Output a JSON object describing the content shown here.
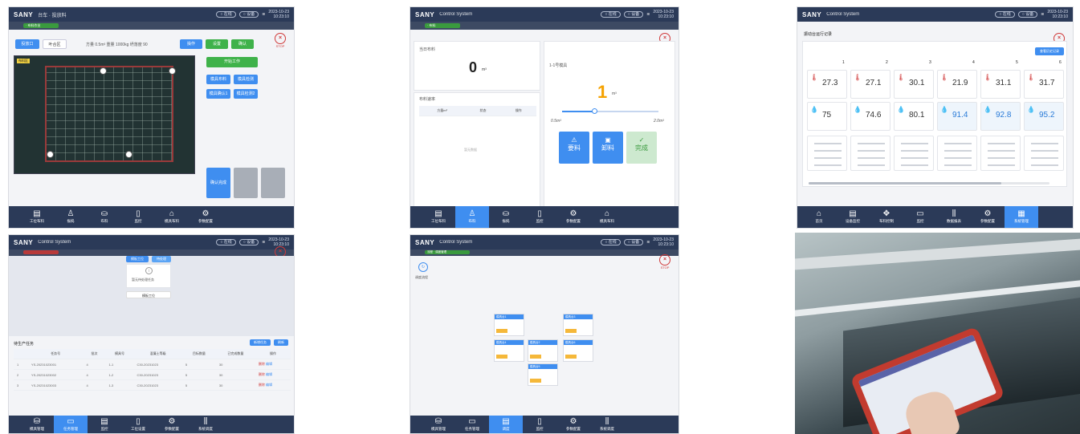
{
  "brand": "SANY",
  "panels": {
    "p1": {
      "title": "台车 · 投放料",
      "tabs": [
        "投放口",
        "叶合区"
      ],
      "meta": "方量 0.5m³  重量 1000kg  坍落度 90",
      "top_buttons": [
        "操作",
        "设置",
        "确认"
      ],
      "cam_label": "布料区",
      "right_buttons": [
        "开始工作"
      ],
      "mid_buttons": [
        "模具布料",
        "模具检测",
        "模具确认1",
        "模具检测2"
      ],
      "bottom_buttons": [
        "确认完成",
        "",
        ""
      ],
      "nav": [
        "工位布料",
        "振捣",
        "布料",
        "监控",
        "模具布料",
        "参数配置"
      ]
    },
    "p2": {
      "title": "Control System",
      "left_title": "当日布料",
      "value": "0",
      "unit": "m³",
      "rate_title": "布料速率",
      "table_headers": [
        "方量m³",
        "状态",
        "操作"
      ],
      "empty": "暂无数据",
      "right_title": "1-1号模具",
      "big": "1",
      "slider_min": "0.5m³",
      "slider_max": "2.0m³",
      "actions": [
        "要料",
        "卸料",
        "完成"
      ],
      "nav": [
        "工位布料",
        "布料",
        "振捣",
        "监控",
        "参数配置",
        "模具布料"
      ]
    },
    "p3": {
      "title": "Control System",
      "section": "振动台运行记录",
      "btn": "查看历史记录",
      "cols": [
        "1",
        "2",
        "3",
        "4",
        "5",
        "6"
      ],
      "temps": [
        "27.3",
        "27.1",
        "30.1",
        "21.9",
        "31.1",
        "31.7"
      ],
      "hums": [
        "75",
        "74.6",
        "80.1",
        "91.4",
        "92.8",
        "95.2"
      ],
      "nav": [
        "首页",
        "设备监控",
        "布料控制",
        "监控",
        "数据报表",
        "参数配置",
        "系统管理"
      ]
    },
    "p4": {
      "title": "Control System",
      "tag1": "模板工位",
      "tag2": "待处理",
      "center_label": "暂无待处理任务",
      "action": "模板工位",
      "list_title": "待生产任务",
      "list_btns": [
        "新增任务",
        "刷新"
      ],
      "headers": [
        "任务号",
        "批次",
        "模具号",
        "混凝土等级",
        "目标数量",
        "已完成数量",
        "操作"
      ],
      "rows": [
        [
          "1",
          "YS-20231023001",
          "4",
          "1-1",
          "C30-20231023",
          "5",
          "30",
          "删除",
          "编辑"
        ],
        [
          "2",
          "YS-20231023002",
          "4",
          "1-2",
          "C30-20231023",
          "5",
          "30",
          "删除",
          "编辑"
        ],
        [
          "3",
          "YS-20231023003",
          "4",
          "1-3",
          "C30-20231023",
          "5",
          "30",
          "删除",
          "编辑"
        ]
      ],
      "nav": [
        "模具管理",
        "任务管理",
        "监控",
        "工位设置",
        "参数配置",
        "系统调度"
      ]
    },
    "p5": {
      "title": "Control System",
      "crumb": "流程 · 调度管理",
      "flow_label": "调度流程",
      "nodes": [
        "模具台1",
        "模具台2",
        "模具台3",
        "模具台4",
        "模具台5",
        "模具台6"
      ],
      "nav": [
        "模具管理",
        "任务管理",
        "调度",
        "监控",
        "参数配置",
        "系统调度"
      ]
    }
  },
  "colors": {
    "header": "#2b3a58",
    "accent": "#3f8ef0",
    "green": "#3fb24a",
    "stop": "#d03a3a"
  }
}
